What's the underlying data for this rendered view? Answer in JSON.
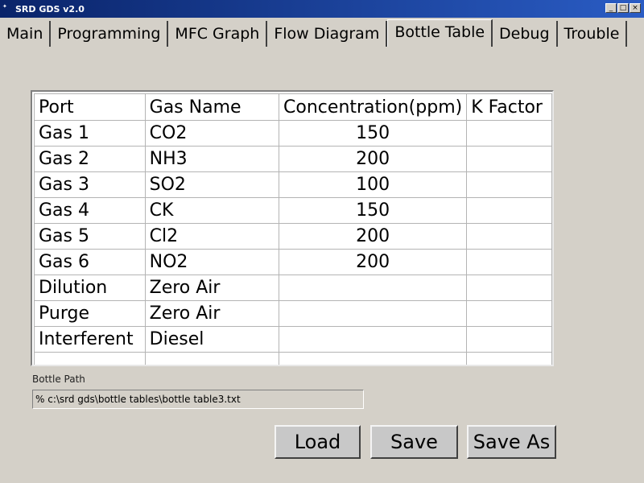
{
  "window": {
    "title": "SRD GDS v2.0",
    "controls": [
      "_",
      "□",
      "×"
    ]
  },
  "tabs": [
    {
      "label": "Main",
      "active": false
    },
    {
      "label": "Programming",
      "active": false
    },
    {
      "label": "MFC Graph",
      "active": false
    },
    {
      "label": "Flow Diagram",
      "active": false
    },
    {
      "label": "Bottle Table",
      "active": true
    },
    {
      "label": "Debug",
      "active": false
    },
    {
      "label": "Trouble",
      "active": false
    }
  ],
  "table": {
    "columns": [
      "Port",
      "Gas Name",
      "Concentration(ppm)",
      "K Factor"
    ],
    "rows": [
      [
        "Gas 1",
        "CO2",
        "150",
        ""
      ],
      [
        "Gas 2",
        "NH3",
        "200",
        ""
      ],
      [
        "Gas 3",
        "SO2",
        "100",
        ""
      ],
      [
        "Gas 4",
        "CK",
        "150",
        ""
      ],
      [
        "Gas 5",
        "Cl2",
        "200",
        ""
      ],
      [
        "Gas 6",
        "NO2",
        "200",
        ""
      ],
      [
        "Dilution",
        "Zero Air",
        "",
        ""
      ],
      [
        "Purge",
        "Zero Air",
        "",
        ""
      ],
      [
        "Interferent",
        "Diesel",
        "",
        ""
      ],
      [
        "",
        "",
        "",
        ""
      ]
    ]
  },
  "bottle_path": {
    "label": "Bottle Path",
    "value": "% c:\\srd gds\\bottle tables\\bottle table3.txt"
  },
  "buttons": {
    "load": "Load",
    "save": "Save",
    "save_as": "Save As"
  }
}
